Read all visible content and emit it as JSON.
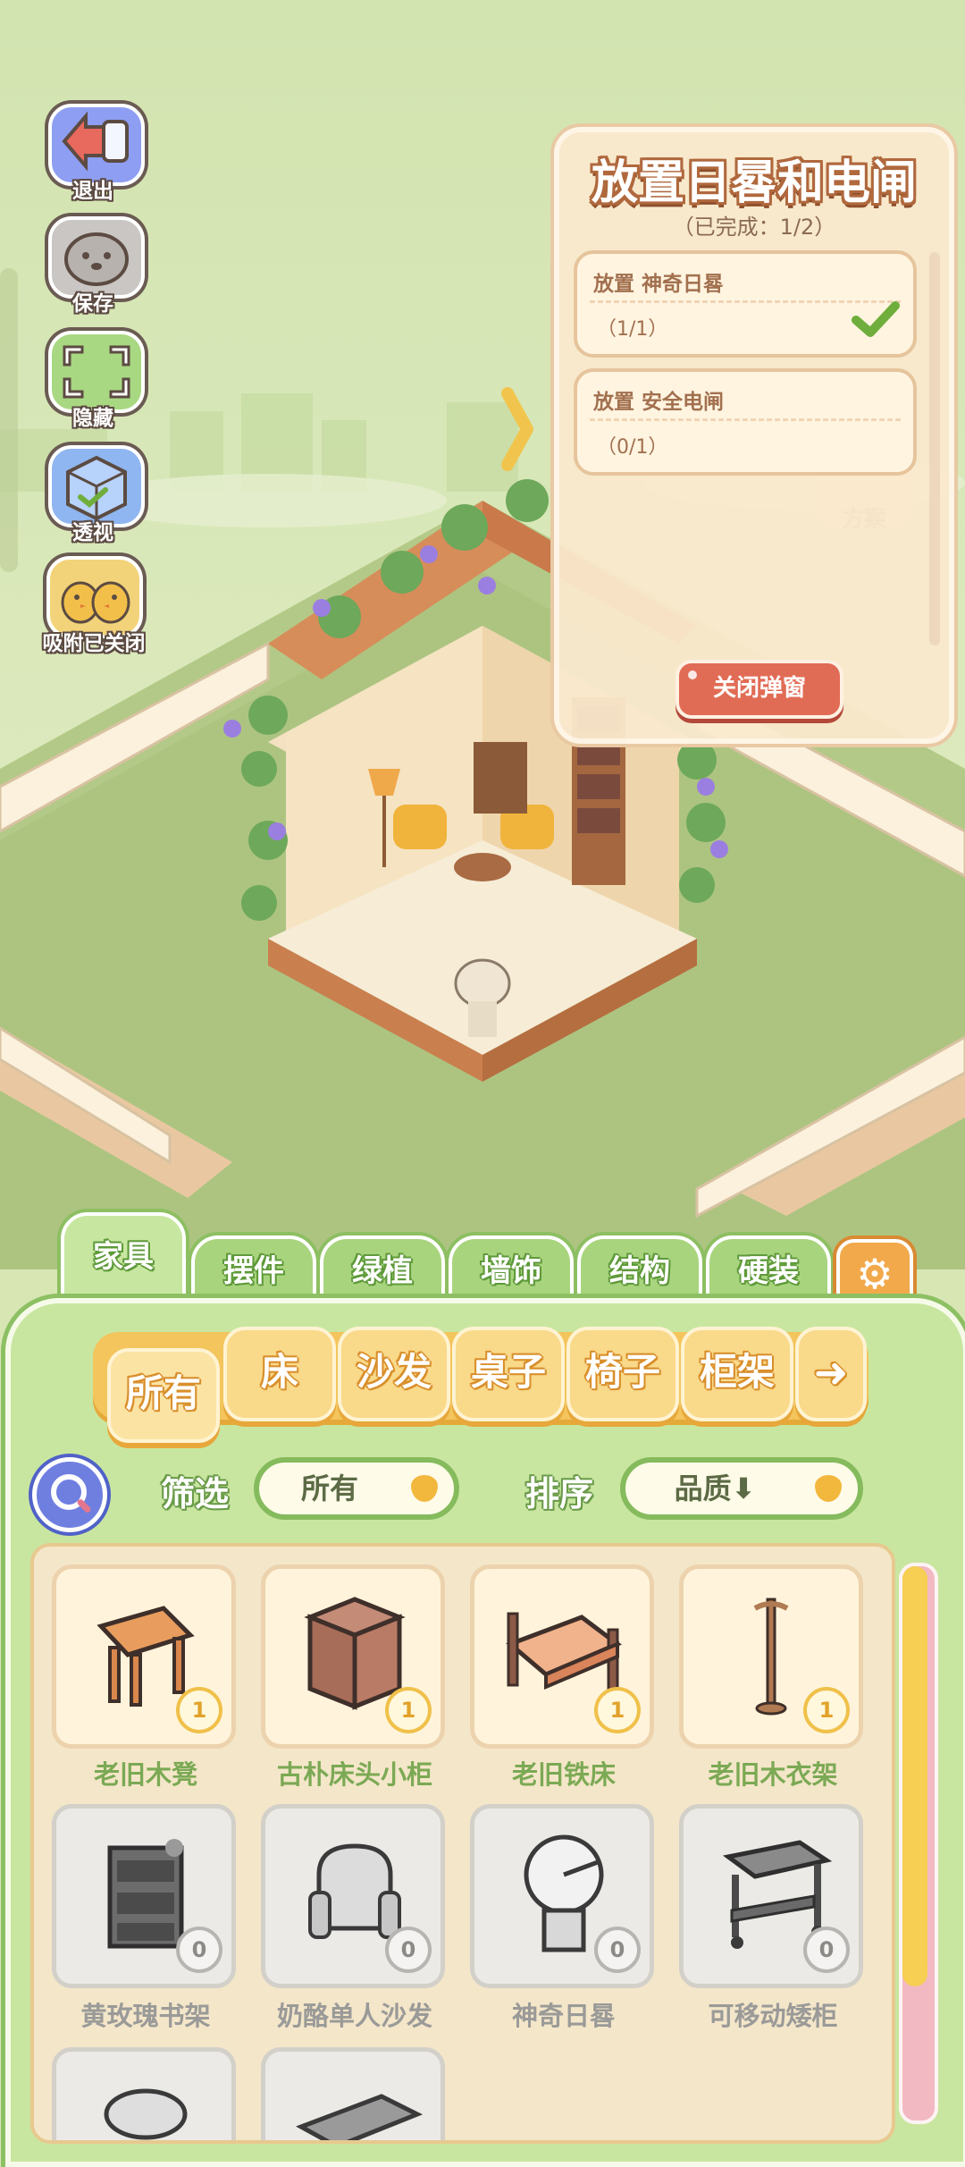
{
  "toolbar": {
    "exit_label": "退出",
    "save_label": "保存",
    "hide_label": "隐藏",
    "perspective_label": "透视",
    "snap_label": "吸附已关闭"
  },
  "quest": {
    "title": "放置日晷和电闸",
    "progress": "（已完成：1/2）",
    "items": [
      {
        "name": "放置 神奇日晷",
        "count": "（1/1）",
        "done": true
      },
      {
        "name": "放置 安全电闸",
        "count": "（0/1）",
        "done": false
      }
    ],
    "close_label": "关闭弹窗",
    "behind_label": "方案"
  },
  "categories": [
    "家具",
    "摆件",
    "绿植",
    "墙饰",
    "结构",
    "硬装"
  ],
  "active_category": "家具",
  "subcategories": [
    "所有",
    "床",
    "沙发",
    "桌子",
    "椅子",
    "柜架"
  ],
  "active_subcategory": "所有",
  "next_arrow": "➜",
  "filter": {
    "label": "筛选",
    "value": "所有"
  },
  "sort": {
    "label": "排序",
    "value": "品质⬇"
  },
  "items": [
    {
      "name": "老旧木凳",
      "count": "1",
      "owned": true,
      "icon": "wooden-stool"
    },
    {
      "name": "古朴床头小柜",
      "count": "1",
      "owned": true,
      "icon": "nightstand"
    },
    {
      "name": "老旧铁床",
      "count": "1",
      "owned": true,
      "icon": "iron-bed"
    },
    {
      "name": "老旧木衣架",
      "count": "1",
      "owned": true,
      "icon": "coat-rack"
    },
    {
      "name": "黄玫瑰书架",
      "count": "0",
      "owned": false,
      "icon": "bookshelf"
    },
    {
      "name": "奶酪单人沙发",
      "count": "0",
      "owned": false,
      "icon": "armchair"
    },
    {
      "name": "神奇日晷",
      "count": "0",
      "owned": false,
      "icon": "sundial"
    },
    {
      "name": "可移动矮柜",
      "count": "0",
      "owned": false,
      "icon": "trolley-cabinet"
    }
  ],
  "colors": {
    "accent_green": "#8dc063",
    "accent_orange": "#f3c55c",
    "check_green": "#6fae3c"
  }
}
